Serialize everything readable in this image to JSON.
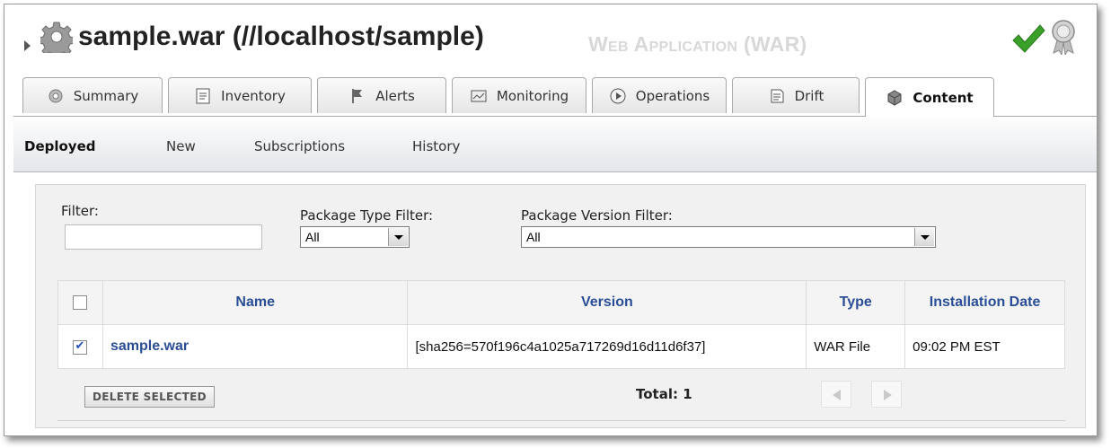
{
  "header": {
    "title": "sample.war (//localhost/sample)",
    "subtitle": "Web Application (WAR)",
    "status_icon": "check-icon",
    "badge_icon": "ribbon-icon"
  },
  "tabs": [
    {
      "label": "Summary",
      "icon": "gear-icon"
    },
    {
      "label": "Inventory",
      "icon": "clipboard-icon"
    },
    {
      "label": "Alerts",
      "icon": "flag-icon"
    },
    {
      "label": "Monitoring",
      "icon": "chart-icon"
    },
    {
      "label": "Operations",
      "icon": "play-icon"
    },
    {
      "label": "Drift",
      "icon": "document-icon"
    },
    {
      "label": "Content",
      "icon": "cube-icon",
      "active": true
    }
  ],
  "subnav": [
    "Deployed",
    "New",
    "Subscriptions",
    "History"
  ],
  "filters": {
    "filter_label": "Filter:",
    "filter_value": "",
    "package_type_label": "Package Type Filter:",
    "package_type_value": "All",
    "package_version_label": "Package Version Filter:",
    "package_version_value": "All"
  },
  "table": {
    "columns": [
      "Name",
      "Version",
      "Type",
      "Installation Date"
    ],
    "rows": [
      {
        "checked": true,
        "name": "sample.war",
        "version": "[sha256=570f196c4a1025a717269d16d11d6f37]",
        "type": "WAR File",
        "date": "09:02 PM EST"
      }
    ]
  },
  "footer": {
    "delete_label": "DELETE SELECTED",
    "total": "Total: 1"
  },
  "colors": {
    "link": "#2a4e96",
    "check": "#3aa02a"
  }
}
